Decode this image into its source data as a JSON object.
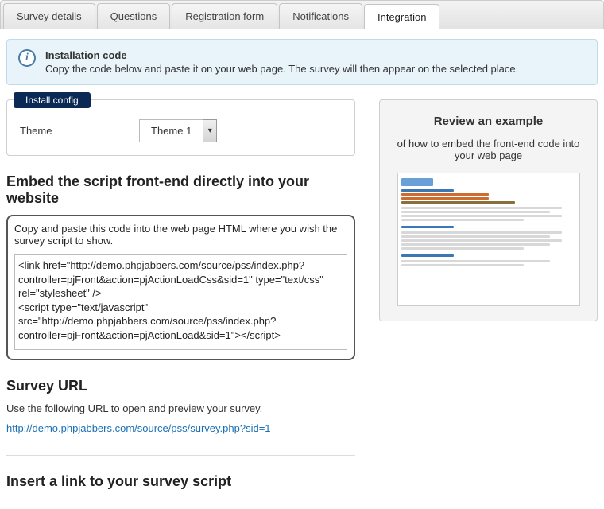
{
  "tabs": {
    "t0": "Survey details",
    "t1": "Questions",
    "t2": "Registration form",
    "t3": "Notifications",
    "t4": "Integration"
  },
  "info": {
    "title": "Installation code",
    "text": "Copy the code below and paste it on your web page. The survey will then appear on the selected place."
  },
  "config": {
    "legend": "Install config",
    "theme_label": "Theme",
    "theme_value": "Theme 1"
  },
  "embed": {
    "heading": "Embed the script front-end directly into your website",
    "desc": "Copy and paste this code into the web page HTML where you wish the survey script to show.",
    "code": "<link href=\"http://demo.phpjabbers.com/source/pss/index.php?controller=pjFront&action=pjActionLoadCss&sid=1\" type=\"text/css\" rel=\"stylesheet\" />\n<script type=\"text/javascript\" src=\"http://demo.phpjabbers.com/source/pss/index.php?controller=pjFront&action=pjActionLoad&sid=1\"></script>"
  },
  "url": {
    "heading": "Survey URL",
    "text": "Use the following URL to open and preview your survey.",
    "link": "http://demo.phpjabbers.com/source/pss/survey.php?sid=1"
  },
  "insert": {
    "heading": "Insert a link to your survey script"
  },
  "example": {
    "title": "Review an example",
    "sub": "of how to embed the front-end code into your web page"
  }
}
